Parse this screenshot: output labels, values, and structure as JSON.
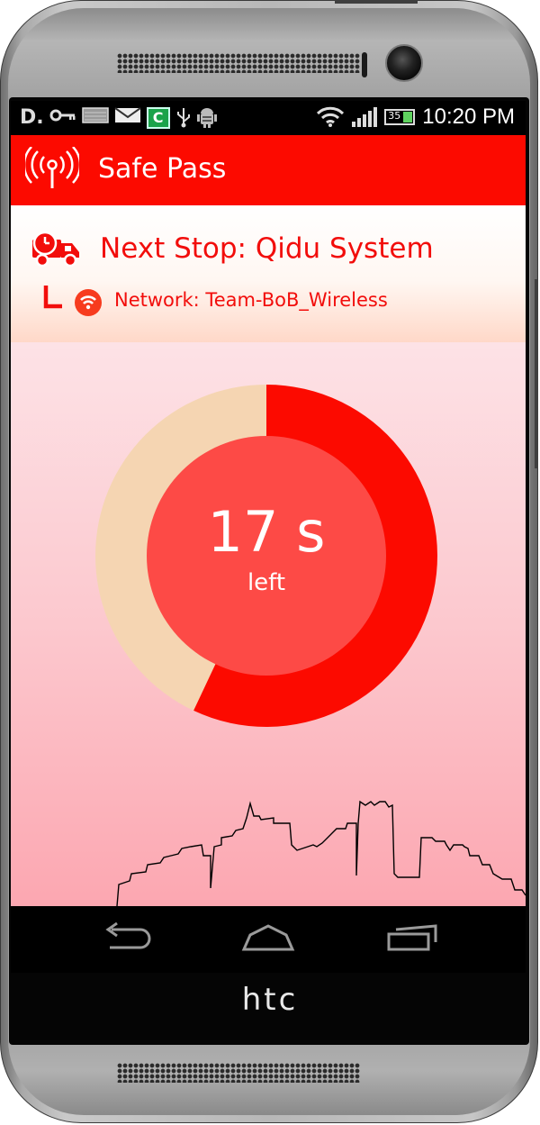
{
  "status_bar": {
    "time": "10:20 PM",
    "battery_level": "35",
    "icons": [
      "d-icon",
      "key-icon",
      "image-icon",
      "mail-icon",
      "c-app-icon",
      "usb-icon",
      "android-debug-icon",
      "wifi-icon",
      "signal-icon",
      "battery-icon"
    ],
    "c_icon_label": "C"
  },
  "app_bar": {
    "title": "Safe Pass",
    "icon": "broadcast-icon"
  },
  "stop": {
    "title": "Next Stop: Qidu  System",
    "network": "Network: Team-BoB_Wireless",
    "icons": [
      "truck-clock-icon",
      "corner-arrow-icon",
      "wifi-badge-icon"
    ]
  },
  "timer": {
    "value": "17 s",
    "sub": "left",
    "elapsed_fraction": 0.57,
    "colors": {
      "elapsed": "#fc0a00",
      "remaining": "#f5d5b2",
      "inner": "#fd4a46"
    }
  },
  "nav": {
    "icons": [
      "back-icon",
      "home-icon",
      "recents-icon"
    ]
  },
  "device": {
    "brand": "htc"
  },
  "colors": {
    "accent": "#fc0a00",
    "text_red": "#f20d0b"
  }
}
